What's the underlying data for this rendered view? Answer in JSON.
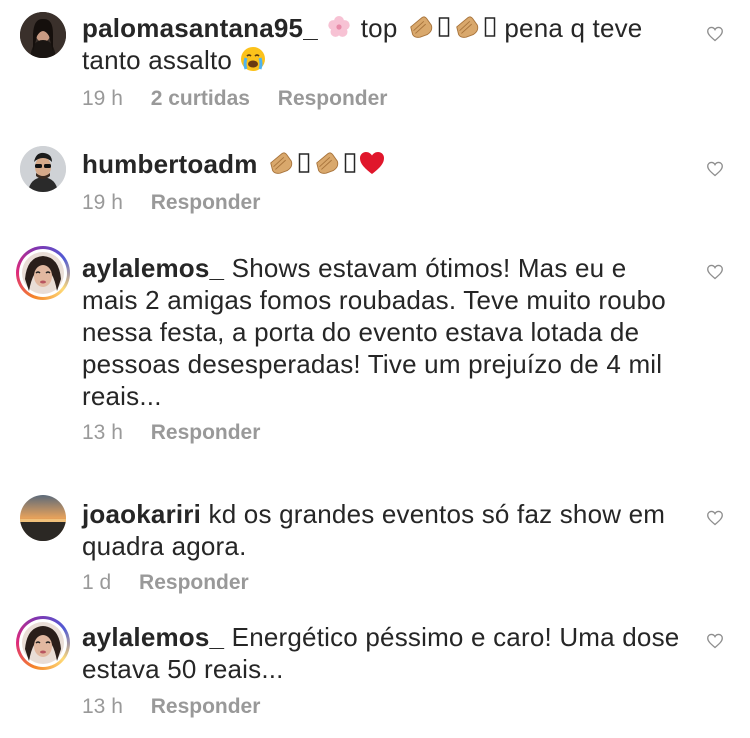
{
  "comments": [
    {
      "username": "palomasantana95_",
      "text_part1": "top",
      "text_part2": "pena q teve",
      "text_part3": "tanto assalto",
      "time": "19 h",
      "likes": "2 curtidas",
      "reply": "Responder"
    },
    {
      "username": "humbertoadm",
      "time": "19 h",
      "reply": "Responder"
    },
    {
      "username": "aylalemos_",
      "lines": [
        "Shows estavam ótimos! Mas eu e",
        "mais 2 amigas fomos roubadas. Teve muito roubo",
        "nessa festa, a porta do evento estava lotada de",
        "pessoas desesperadas! Tive um prejuízo de 4 mil",
        "reais..."
      ],
      "time": "13 h",
      "reply": "Responder"
    },
    {
      "username": "joaokariri",
      "lines": [
        "kd os grandes eventos só faz show em",
        "quadra agora."
      ],
      "time": "1 d",
      "reply": "Responder"
    },
    {
      "username": "aylalemos_",
      "lines": [
        "Energético péssimo e caro! Uma dose",
        "estava 50 reais..."
      ],
      "time": "13 h",
      "reply": "Responder"
    }
  ],
  "icons": {
    "emoji_flower": "cherry-blossom",
    "emoji_clap": "clapping-hands",
    "emoji_cry": "crying-face",
    "emoji_heart": "red-heart",
    "like": "heart-outline"
  },
  "colors": {
    "text": "#262626",
    "meta": "#999999",
    "heart_emoji": "#e0162b"
  }
}
